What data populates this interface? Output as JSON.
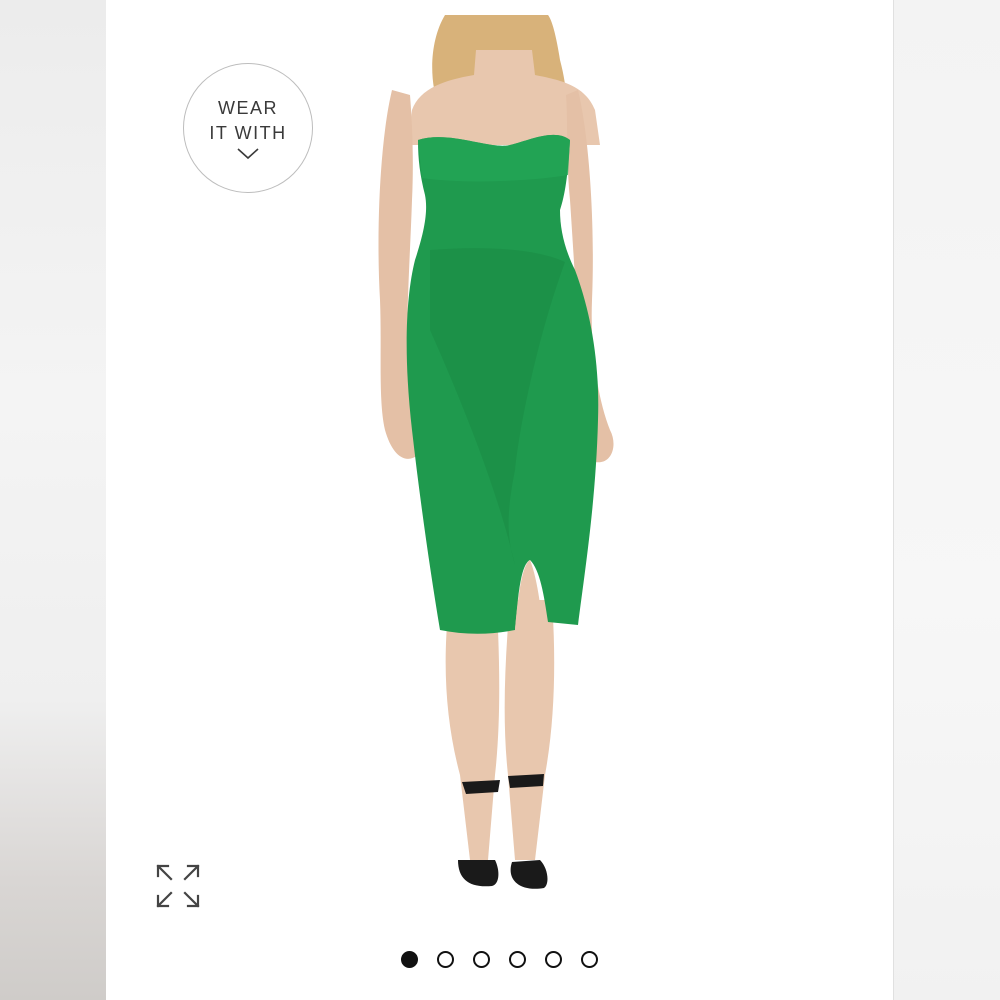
{
  "wear_it_with": {
    "line1": "WEAR",
    "line2": "IT WITH"
  },
  "icons": {
    "chevron": "chevron-down-icon",
    "expand": "expand-arrows-icon"
  },
  "carousel": {
    "total": 6,
    "active_index": 0
  },
  "colors": {
    "dress": "#1f9a4e",
    "skin": "#e8c7ae",
    "hair": "#d8b27a",
    "shoes": "#1a1a1a"
  }
}
